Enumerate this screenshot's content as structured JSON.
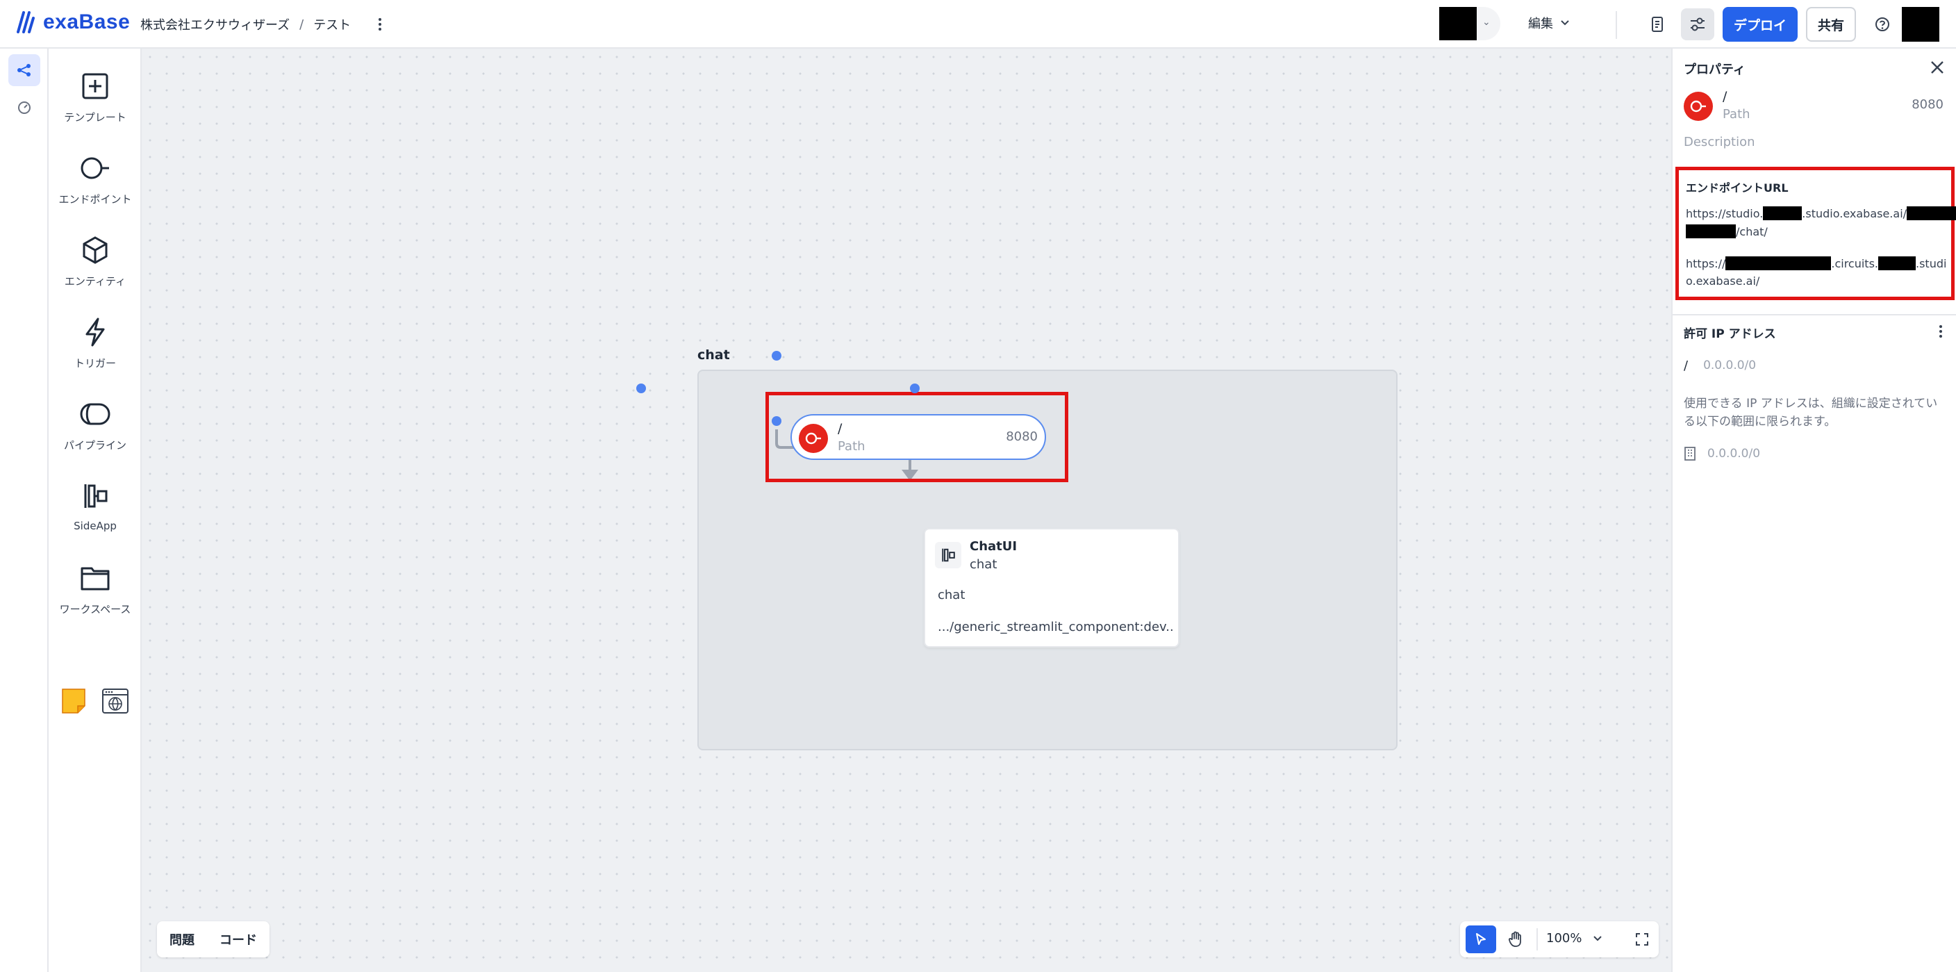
{
  "app": {
    "logo_text": "exaBase"
  },
  "breadcrumb": {
    "org": "株式会社エクサウィザーズ",
    "separator": "/",
    "project": "テスト"
  },
  "header": {
    "mode_label": "編集",
    "deploy_label": "デプロイ",
    "share_label": "共有"
  },
  "palette": [
    {
      "label": "テンプレート",
      "icon": "plus-square-icon"
    },
    {
      "label": "エンドポイント",
      "icon": "endpoint-icon"
    },
    {
      "label": "エンティティ",
      "icon": "cube-icon"
    },
    {
      "label": "トリガー",
      "icon": "lightning-icon"
    },
    {
      "label": "パイプライン",
      "icon": "pipeline-icon"
    },
    {
      "label": "SideApp",
      "icon": "sideapp-icon"
    },
    {
      "label": "ワークスペース",
      "icon": "folder-icon"
    }
  ],
  "canvas": {
    "group_label": "chat",
    "path_node": {
      "name": "/",
      "type": "Path",
      "port": "8080"
    },
    "chat_node": {
      "title": "ChatUI",
      "subtitle": "chat",
      "description": "chat",
      "image": ".../generic_streamlit_component:dev..."
    },
    "bottom_tabs": {
      "issues": "問題",
      "code": "コード"
    },
    "zoom": "100%"
  },
  "panel": {
    "title": "プロパティ",
    "endpoint": {
      "name": "/",
      "type": "Path",
      "port": "8080"
    },
    "description_placeholder": "Description",
    "url_section": {
      "title": "エンドポイントURL",
      "url1_prefix": "https://studio.",
      "url1_mid": ".studio.exabase.ai/",
      "url1_suffix": "/chat/",
      "url2_prefix": "https://",
      "url2_mid": ".circuits.",
      "url2_mid_end": ".studi",
      "url2_suffix": "o.exabase.ai/"
    },
    "ip_section": {
      "title": "許可 IP アドレス",
      "slash": "/",
      "allowed_ip": "0.0.0.0/0",
      "note": "使用できる IP アドレスは、組織に設定されている以下の範囲に限られます。",
      "org_ip": "0.0.0.0/0"
    }
  },
  "colors": {
    "accent": "#2563eb",
    "endpoint_badge": "#e5251c",
    "highlight": "#e11414"
  }
}
